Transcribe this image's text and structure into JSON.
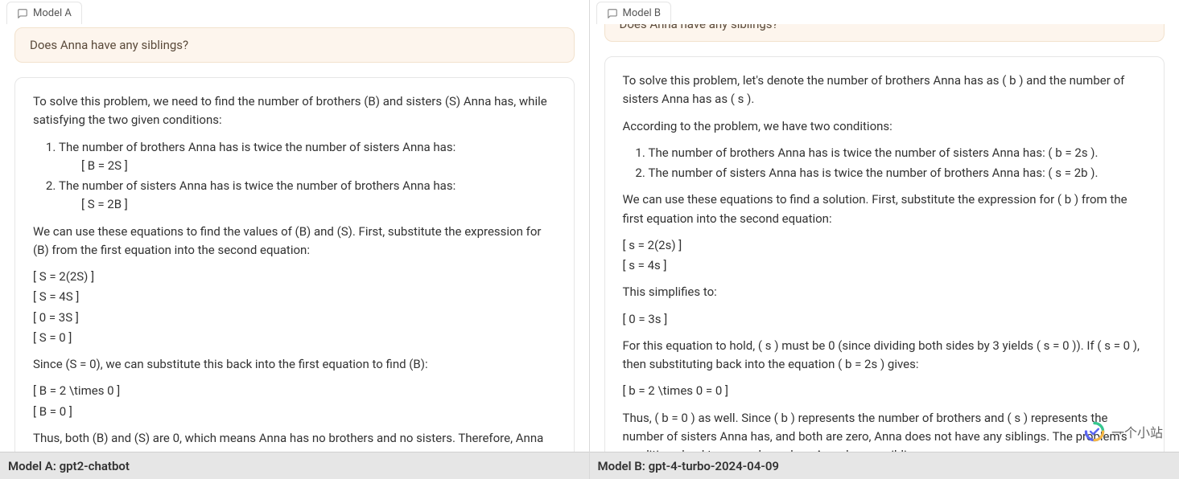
{
  "columns": {
    "a": {
      "tab_label": "Model A",
      "footer": "Model A: gpt2-chatbot",
      "user_prompt": "Does Anna have any siblings?",
      "assistant": {
        "p1": "To solve this problem, we need to find the number of brothers (B) and sisters (S) Anna has, while satisfying the two given conditions:",
        "cond1": "The number of brothers Anna has is twice the number of sisters Anna has:",
        "cond1_eq": "[ B = 2S ]",
        "cond2": "The number of sisters Anna has is twice the number of brothers Anna has:",
        "cond2_eq": "[ S = 2B ]",
        "p2": "We can use these equations to find the values of (B) and (S). First, substitute the expression for (B) from the first equation into the second equation:",
        "eq1": "[ S = 2(2S) ]",
        "eq2": "[ S = 4S ]",
        "eq3": "[ 0 = 3S ]",
        "eq4": "[ S = 0 ]",
        "p3": "Since (S = 0), we can substitute this back into the first equation to find (B):",
        "eq5": "[ B = 2 \\times 0 ]",
        "eq6": "[ B = 0 ]",
        "p4": "Thus, both (B) and (S) are 0, which means Anna has no brothers and no sisters. Therefore, Anna does not have any siblings."
      }
    },
    "b": {
      "tab_label": "Model B",
      "footer": "Model B: gpt-4-turbo-2024-04-09",
      "user_prompt": "Does Anna have any siblings?",
      "assistant": {
        "p1": "To solve this problem, let's denote the number of brothers Anna has as ( b ) and the number of sisters Anna has as ( s ).",
        "p2": "According to the problem, we have two conditions:",
        "cond1": "The number of brothers Anna has is twice the number of sisters Anna has: ( b = 2s ).",
        "cond2": "The number of sisters Anna has is twice the number of brothers Anna has: ( s = 2b ).",
        "p3": "We can use these equations to find a solution. First, substitute the expression for ( b ) from the first equation into the second equation:",
        "eq1": "[ s = 2(2s) ]",
        "eq2": "[ s = 4s ]",
        "p4": "This simplifies to:",
        "eq3": "[ 0 = 3s ]",
        "p5": "For this equation to hold, ( s ) must be 0 (since dividing both sides by 3 yields ( s = 0 )). If ( s = 0 ), then substituting back into the equation ( b = 2s ) gives:",
        "eq4": "[ b = 2 \\times 0 = 0 ]",
        "p6": "Thus, ( b = 0 ) as well. Since ( b ) represents the number of brothers and ( s ) represents the number of sisters Anna has, and both are zero, Anna does not have any siblings. The problem's conditions lead to a paradox unless Anna has no siblings."
      }
    }
  },
  "brand": {
    "text": "一个小站"
  },
  "icons": {
    "chat": "chat-icon"
  }
}
